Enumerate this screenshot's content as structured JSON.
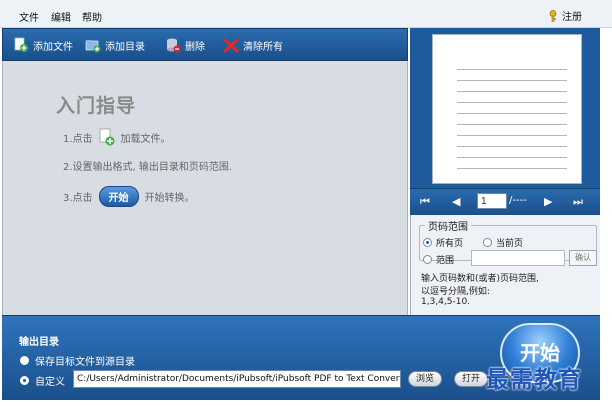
{
  "menu": {
    "file": "文件",
    "edit": "编辑",
    "help": "帮助",
    "register": "注册"
  },
  "toolbar": {
    "add_file": "添加文件",
    "add_dir": "添加目录",
    "delete": "删除",
    "clear_all": "清除所有"
  },
  "guide": {
    "title": "入门指导",
    "step1_pre": "1.点击",
    "step1_post": "加载文件。",
    "step2": "2.设置输出格式, 输出目录和页码范围.",
    "step3_pre": "3.点击",
    "step3_button": "开始",
    "step3_post": "开始转换。"
  },
  "pager": {
    "current_page": "1",
    "total": "/----"
  },
  "page_range": {
    "legend": "页码范围",
    "all_pages": "所有页",
    "current_page": "当前页",
    "range": "范围",
    "range_value": "",
    "confirm": "确认",
    "hint1": "输入页码数和(或者)页码范围,",
    "hint2": "以逗号分隔,例如:",
    "hint3": "1,3,4,5-10.",
    "selected": "all_pages"
  },
  "output": {
    "title": "输出目录",
    "save_to_source": "保存目标文件到源目录",
    "custom": "自定义",
    "path": "C:/Users/Administrator/Documents/iPubsoft/iPubsoft PDF to Text Converter",
    "browse": "浏览",
    "open": "打开",
    "selected": "custom"
  },
  "start_button": "开始",
  "watermark": "最需教育",
  "colors": {
    "toolbar_blue": "#1f5a9c",
    "guide_bg": "#d8dde3",
    "accent": "#2f7fd6"
  }
}
